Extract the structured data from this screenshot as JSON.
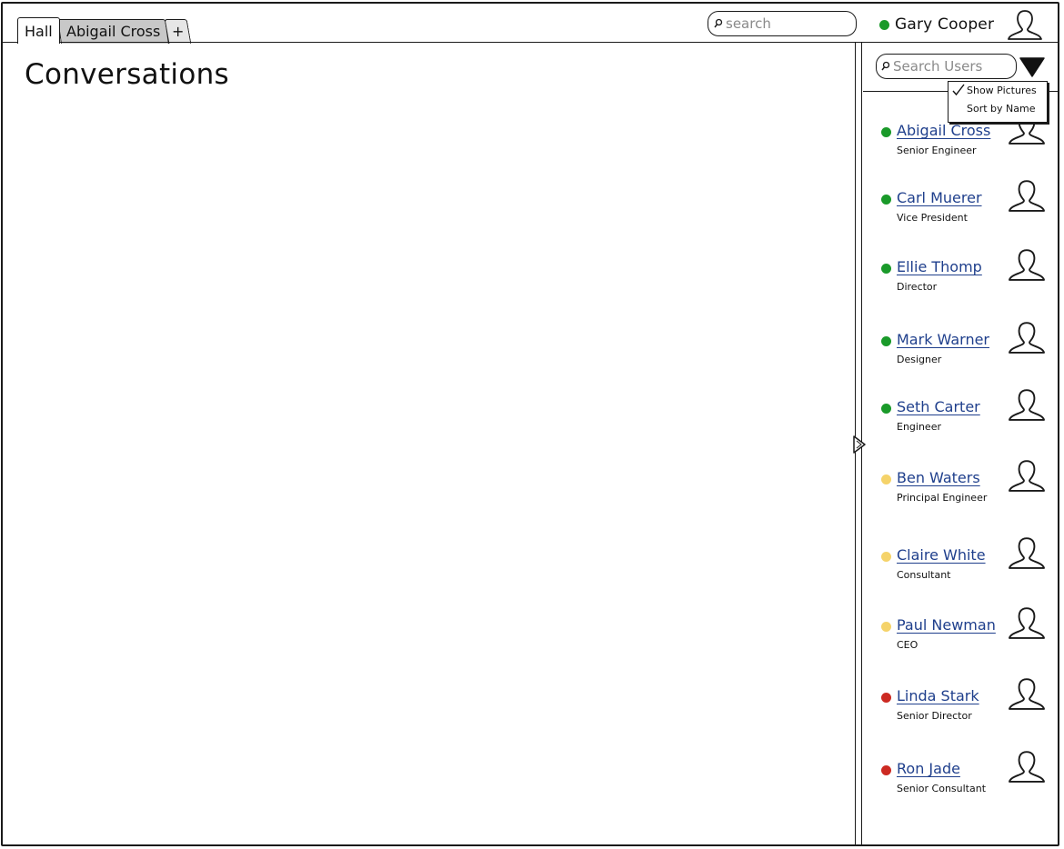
{
  "tabs": [
    {
      "label": "Hall",
      "active": true
    },
    {
      "label": "Abigail Cross",
      "active": false
    }
  ],
  "new_tab_label": "+",
  "top_search": {
    "placeholder": "search"
  },
  "current_user": {
    "name": "Gary Cooper",
    "status_color": "#1a9a2a"
  },
  "main": {
    "title": "Conversations"
  },
  "sidebar": {
    "search_placeholder": "Search Users",
    "menu": {
      "show_pictures": {
        "label": "Show Pictures",
        "checked": true
      },
      "sort_by_name": {
        "label": "Sort by Name",
        "checked": false
      }
    },
    "users": [
      {
        "name": "Abigail Cross",
        "role": "Senior Engineer",
        "status": "online"
      },
      {
        "name": "Carl Muerer",
        "role": "Vice President",
        "status": "online"
      },
      {
        "name": "Ellie Thomp",
        "role": "Director",
        "status": "online"
      },
      {
        "name": "Mark Warner",
        "role": "Designer",
        "status": "online"
      },
      {
        "name": "Seth Carter",
        "role": "Engineer",
        "status": "online"
      },
      {
        "name": "Ben Waters",
        "role": "Principal Engineer",
        "status": "away"
      },
      {
        "name": "Claire White",
        "role": "Consultant",
        "status": "away"
      },
      {
        "name": "Paul Newman",
        "role": "CEO",
        "status": "away"
      },
      {
        "name": "Linda Stark",
        "role": "Senior Director",
        "status": "busy"
      },
      {
        "name": "Ron Jade",
        "role": "Senior Consultant",
        "status": "busy"
      }
    ],
    "status_colors": {
      "online": "#1a9a2a",
      "away": "#f5d36a",
      "busy": "#cc2a22"
    }
  },
  "icons": {
    "tab_search": "search-icon",
    "user_search": "search-icon",
    "avatar": "user-avatar-icon",
    "sort_toggle": "triangle-down-icon",
    "check": "checkmark-icon",
    "splitter": "splitter-arrow-icon"
  }
}
